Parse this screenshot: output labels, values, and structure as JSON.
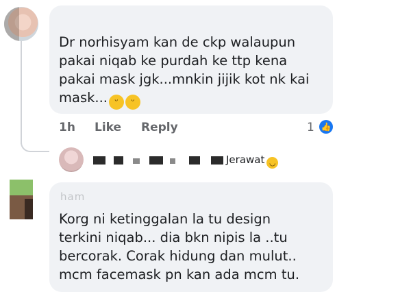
{
  "comment1": {
    "author_faded": "",
    "text": "Dr norhisyam kan de ckp walaupun\npakai niqab ke purdah ke ttp kena\npakai mask jgk...mnkin jijik kot nk kai\nmask...",
    "emojis": [
      "😁",
      "😁"
    ],
    "time": "1h",
    "like_label": "Like",
    "reply_label": "Reply",
    "reaction_count": "1",
    "reaction_icon": "like-thumb-icon"
  },
  "reply_preview": {
    "text": "Jerawat",
    "emoji": "laughing-emoji"
  },
  "comment2": {
    "author_faded": "ham",
    "text": "Korg ni ketinggalan la tu design\nterkini niqab... dia bkn nipis la ..tu\nbercorak. Corak hidung dan mulut..\nmcm facemask pn kan ada mcm tu."
  },
  "colors": {
    "bubble": "#f0f2f5",
    "action_text": "#65676b",
    "like_blue": "#1877f2"
  }
}
